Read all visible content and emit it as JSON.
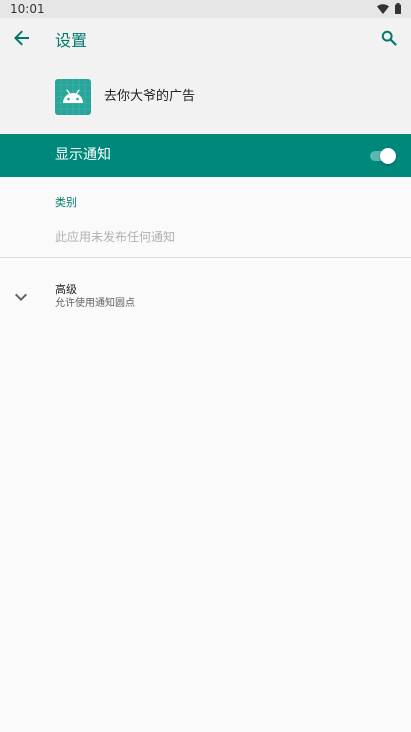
{
  "status_bar": {
    "time": "10:01",
    "icons": [
      "wifi-icon",
      "battery-icon"
    ]
  },
  "toolbar": {
    "title": "设置",
    "back_icon": "arrow-back-icon",
    "search_icon": "search-icon"
  },
  "app": {
    "name": "去你大爷的广告",
    "icon": "android-icon"
  },
  "master_switch": {
    "label": "显示通知",
    "checked": true
  },
  "category": {
    "header": "类别",
    "empty_text": "此应用未发布任何通知"
  },
  "advanced": {
    "title": "高级",
    "summary": "允许使用通知圆点",
    "icon": "chevron-down-icon"
  },
  "colors": {
    "accent": "#00796b",
    "master_bar": "#00897b",
    "app_icon_bg": "#26a69a",
    "background": "#fafafa",
    "toolbar_bg": "#f2f2f2"
  }
}
